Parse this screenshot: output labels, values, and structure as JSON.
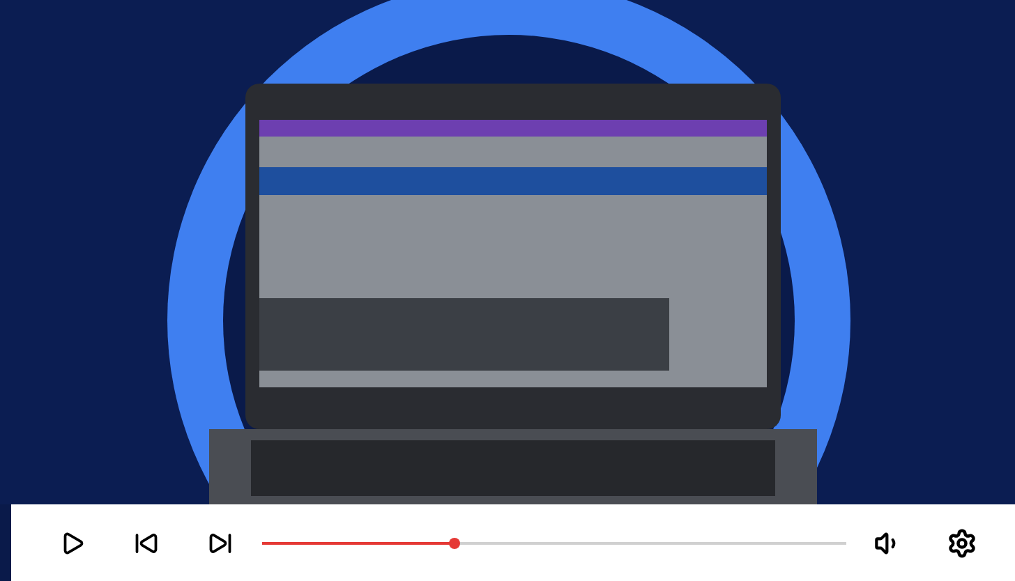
{
  "player": {
    "playing": false,
    "progress": {
      "level": 0.33
    }
  }
}
